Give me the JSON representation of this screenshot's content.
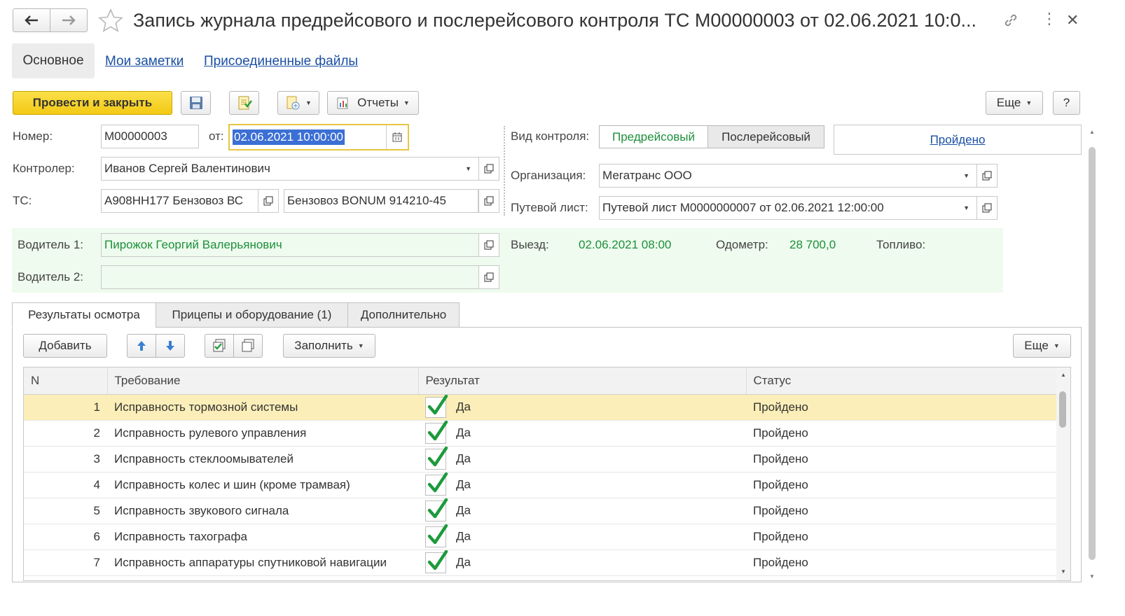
{
  "window": {
    "title": "Запись журнала предрейсового и послерейсового контроля ТС М00000003 от 02.06.2021 10:0..."
  },
  "nav_tabs": [
    "Основное",
    "Мои заметки",
    "Присоединенные файлы"
  ],
  "toolbar": {
    "post_close": "Провести и закрыть",
    "reports": "Отчеты",
    "more": "Еще",
    "help": "?"
  },
  "form": {
    "number_label": "Номер:",
    "number_value": "М00000003",
    "date_label": "от:",
    "date_value": "02.06.2021 10:00:00",
    "controller_label": "Контролер:",
    "controller_value": "Иванов Сергей Валентинович",
    "ts_label": "ТС:",
    "ts_value": "А908НН177 Бензовоз ВС",
    "ts_model": "Бензовоз BONUM 914210-45",
    "control_type_label": "Вид контроля:",
    "control_type_options": [
      "Предрейсовый",
      "Послерейсовый"
    ],
    "status_link": "Пройдено",
    "org_label": "Организация:",
    "org_value": "Мегатранс ООО",
    "waybill_label": "Путевой лист:",
    "waybill_value": "Путевой лист М0000000007 от 02.06.2021 12:00:00"
  },
  "drivers": {
    "driver1_label": "Водитель 1:",
    "driver1_value": "Пирожок Георгий Валерьянович",
    "driver2_label": "Водитель 2:",
    "driver2_value": "",
    "departure_label": "Выезд:",
    "departure_value": "02.06.2021 08:00",
    "odometer_label": "Одометр:",
    "odometer_value": "28 700,0",
    "fuel_label": "Топливо:"
  },
  "content_tabs": [
    "Результаты осмотра",
    "Прицепы и оборудование (1)",
    "Дополнительно"
  ],
  "table_toolbar": {
    "add": "Добавить",
    "fill": "Заполнить",
    "more": "Еще"
  },
  "table": {
    "columns": [
      "N",
      "Требование",
      "Результат",
      "Статус"
    ],
    "rows": [
      {
        "n": "1",
        "requirement": "Исправность тормозной системы",
        "result": "Да",
        "status": "Пройдено"
      },
      {
        "n": "2",
        "requirement": "Исправность рулевого управления",
        "result": "Да",
        "status": "Пройдено"
      },
      {
        "n": "3",
        "requirement": "Исправность стеклоомывателей",
        "result": "Да",
        "status": "Пройдено"
      },
      {
        "n": "4",
        "requirement": "Исправность колес и шин (кроме трамвая)",
        "result": "Да",
        "status": "Пройдено"
      },
      {
        "n": "5",
        "requirement": "Исправность звукового сигнала",
        "result": "Да",
        "status": "Пройдено"
      },
      {
        "n": "6",
        "requirement": "Исправность тахографа",
        "result": "Да",
        "status": "Пройдено"
      },
      {
        "n": "7",
        "requirement": "Исправность аппаратуры спутниковой навигации",
        "result": "Да",
        "status": "Пройдено"
      }
    ]
  },
  "colors": {
    "primary_button": "#f7d32a",
    "green_text": "#1d8f3a",
    "driver_panel_bg": "#eefbee",
    "selected_row": "#fbeeb8",
    "link": "#1a4fa3"
  }
}
